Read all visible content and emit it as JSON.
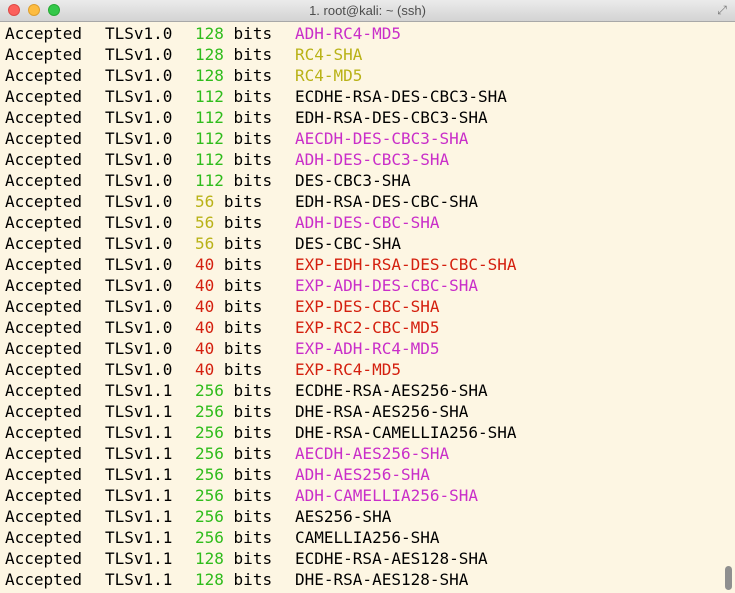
{
  "window": {
    "title": "1. root@kali: ~ (ssh)"
  },
  "colors": {
    "green": "#2fbc1c",
    "yellow": "#b9b217",
    "red": "#d41f0e",
    "magenta": "#c92ec9",
    "black": "#000000"
  },
  "rows": [
    {
      "status": "Accepted",
      "protocol": "TLSv1.0",
      "bits": "128",
      "bits_unit": "bits",
      "bits_color": "#2fbc1c",
      "cipher": "ADH-RC4-MD5",
      "cipher_color": "#c92ec9"
    },
    {
      "status": "Accepted",
      "protocol": "TLSv1.0",
      "bits": "128",
      "bits_unit": "bits",
      "bits_color": "#2fbc1c",
      "cipher": "RC4-SHA",
      "cipher_color": "#b9b217"
    },
    {
      "status": "Accepted",
      "protocol": "TLSv1.0",
      "bits": "128",
      "bits_unit": "bits",
      "bits_color": "#2fbc1c",
      "cipher": "RC4-MD5",
      "cipher_color": "#b9b217"
    },
    {
      "status": "Accepted",
      "protocol": "TLSv1.0",
      "bits": "112",
      "bits_unit": "bits",
      "bits_color": "#2fbc1c",
      "cipher": "ECDHE-RSA-DES-CBC3-SHA",
      "cipher_color": "#000000"
    },
    {
      "status": "Accepted",
      "protocol": "TLSv1.0",
      "bits": "112",
      "bits_unit": "bits",
      "bits_color": "#2fbc1c",
      "cipher": "EDH-RSA-DES-CBC3-SHA",
      "cipher_color": "#000000"
    },
    {
      "status": "Accepted",
      "protocol": "TLSv1.0",
      "bits": "112",
      "bits_unit": "bits",
      "bits_color": "#2fbc1c",
      "cipher": "AECDH-DES-CBC3-SHA",
      "cipher_color": "#c92ec9"
    },
    {
      "status": "Accepted",
      "protocol": "TLSv1.0",
      "bits": "112",
      "bits_unit": "bits",
      "bits_color": "#2fbc1c",
      "cipher": "ADH-DES-CBC3-SHA",
      "cipher_color": "#c92ec9"
    },
    {
      "status": "Accepted",
      "protocol": "TLSv1.0",
      "bits": "112",
      "bits_unit": "bits",
      "bits_color": "#2fbc1c",
      "cipher": "DES-CBC3-SHA",
      "cipher_color": "#000000"
    },
    {
      "status": "Accepted",
      "protocol": "TLSv1.0",
      "bits": "56",
      "bits_unit": "bits",
      "bits_color": "#b9b217",
      "cipher": "EDH-RSA-DES-CBC-SHA",
      "cipher_color": "#000000"
    },
    {
      "status": "Accepted",
      "protocol": "TLSv1.0",
      "bits": "56",
      "bits_unit": "bits",
      "bits_color": "#b9b217",
      "cipher": "ADH-DES-CBC-SHA",
      "cipher_color": "#c92ec9"
    },
    {
      "status": "Accepted",
      "protocol": "TLSv1.0",
      "bits": "56",
      "bits_unit": "bits",
      "bits_color": "#b9b217",
      "cipher": "DES-CBC-SHA",
      "cipher_color": "#000000"
    },
    {
      "status": "Accepted",
      "protocol": "TLSv1.0",
      "bits": "40",
      "bits_unit": "bits",
      "bits_color": "#d41f0e",
      "cipher": "EXP-EDH-RSA-DES-CBC-SHA",
      "cipher_color": "#d41f0e"
    },
    {
      "status": "Accepted",
      "protocol": "TLSv1.0",
      "bits": "40",
      "bits_unit": "bits",
      "bits_color": "#d41f0e",
      "cipher": "EXP-ADH-DES-CBC-SHA",
      "cipher_color": "#c92ec9"
    },
    {
      "status": "Accepted",
      "protocol": "TLSv1.0",
      "bits": "40",
      "bits_unit": "bits",
      "bits_color": "#d41f0e",
      "cipher": "EXP-DES-CBC-SHA",
      "cipher_color": "#d41f0e"
    },
    {
      "status": "Accepted",
      "protocol": "TLSv1.0",
      "bits": "40",
      "bits_unit": "bits",
      "bits_color": "#d41f0e",
      "cipher": "EXP-RC2-CBC-MD5",
      "cipher_color": "#d41f0e"
    },
    {
      "status": "Accepted",
      "protocol": "TLSv1.0",
      "bits": "40",
      "bits_unit": "bits",
      "bits_color": "#d41f0e",
      "cipher": "EXP-ADH-RC4-MD5",
      "cipher_color": "#c92ec9"
    },
    {
      "status": "Accepted",
      "protocol": "TLSv1.0",
      "bits": "40",
      "bits_unit": "bits",
      "bits_color": "#d41f0e",
      "cipher": "EXP-RC4-MD5",
      "cipher_color": "#d41f0e"
    },
    {
      "status": "Accepted",
      "protocol": "TLSv1.1",
      "bits": "256",
      "bits_unit": "bits",
      "bits_color": "#2fbc1c",
      "cipher": "ECDHE-RSA-AES256-SHA",
      "cipher_color": "#000000"
    },
    {
      "status": "Accepted",
      "protocol": "TLSv1.1",
      "bits": "256",
      "bits_unit": "bits",
      "bits_color": "#2fbc1c",
      "cipher": "DHE-RSA-AES256-SHA",
      "cipher_color": "#000000"
    },
    {
      "status": "Accepted",
      "protocol": "TLSv1.1",
      "bits": "256",
      "bits_unit": "bits",
      "bits_color": "#2fbc1c",
      "cipher": "DHE-RSA-CAMELLIA256-SHA",
      "cipher_color": "#000000"
    },
    {
      "status": "Accepted",
      "protocol": "TLSv1.1",
      "bits": "256",
      "bits_unit": "bits",
      "bits_color": "#2fbc1c",
      "cipher": "AECDH-AES256-SHA",
      "cipher_color": "#c92ec9"
    },
    {
      "status": "Accepted",
      "protocol": "TLSv1.1",
      "bits": "256",
      "bits_unit": "bits",
      "bits_color": "#2fbc1c",
      "cipher": "ADH-AES256-SHA",
      "cipher_color": "#c92ec9"
    },
    {
      "status": "Accepted",
      "protocol": "TLSv1.1",
      "bits": "256",
      "bits_unit": "bits",
      "bits_color": "#2fbc1c",
      "cipher": "ADH-CAMELLIA256-SHA",
      "cipher_color": "#c92ec9"
    },
    {
      "status": "Accepted",
      "protocol": "TLSv1.1",
      "bits": "256",
      "bits_unit": "bits",
      "bits_color": "#2fbc1c",
      "cipher": "AES256-SHA",
      "cipher_color": "#000000"
    },
    {
      "status": "Accepted",
      "protocol": "TLSv1.1",
      "bits": "256",
      "bits_unit": "bits",
      "bits_color": "#2fbc1c",
      "cipher": "CAMELLIA256-SHA",
      "cipher_color": "#000000"
    },
    {
      "status": "Accepted",
      "protocol": "TLSv1.1",
      "bits": "128",
      "bits_unit": "bits",
      "bits_color": "#2fbc1c",
      "cipher": "ECDHE-RSA-AES128-SHA",
      "cipher_color": "#000000"
    },
    {
      "status": "Accepted",
      "protocol": "TLSv1.1",
      "bits": "128",
      "bits_unit": "bits",
      "bits_color": "#2fbc1c",
      "cipher": "DHE-RSA-AES128-SHA",
      "cipher_color": "#000000"
    }
  ]
}
